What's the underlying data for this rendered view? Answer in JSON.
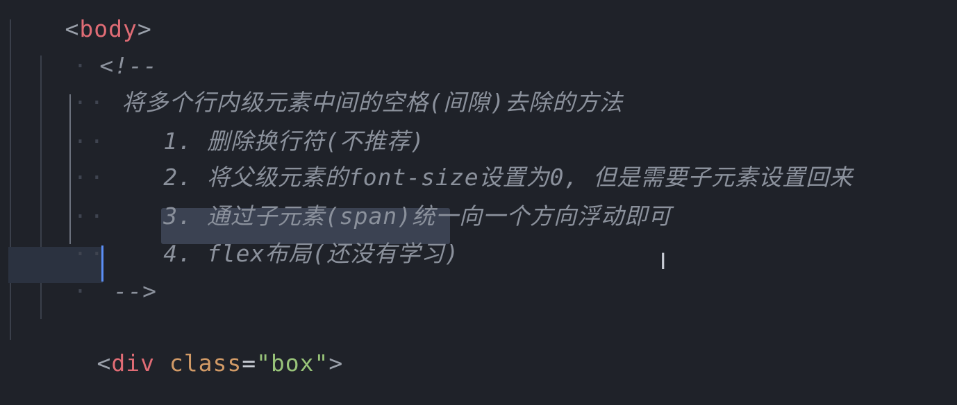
{
  "editor": {
    "lines": {
      "body_open": {
        "bracket_open": "<",
        "tag": "body",
        "bracket_close": ">"
      },
      "comment_open": "<!--",
      "heading": "将多个行内级元素中间的空格(间隙)去除的方法",
      "item1": "1. 删除换行符(不推荐)",
      "item2": "2. 将父级元素的font-size设置为0, 但是需要子元素设置回来",
      "item3": "3. 通过子元素(span)统一向一个方向浮动即可",
      "item4_prefix": "4. f",
      "item4_selected": "lex布局(还没有学习)",
      "comment_close": "-->",
      "div_open": {
        "bracket_open": "<",
        "tag": "div",
        "attr": "class",
        "eq": "=",
        "value": "\"box\"",
        "bracket_close": ">"
      }
    },
    "whitespace_dot": "·",
    "mouse_cursor": "I",
    "colors": {
      "background": "#1f2229",
      "comment": "#8b919c",
      "tag": "#e06c75",
      "attribute": "#d19a66",
      "string": "#98c379",
      "selection": "#3b4252",
      "caret": "#5b8ef5"
    }
  }
}
